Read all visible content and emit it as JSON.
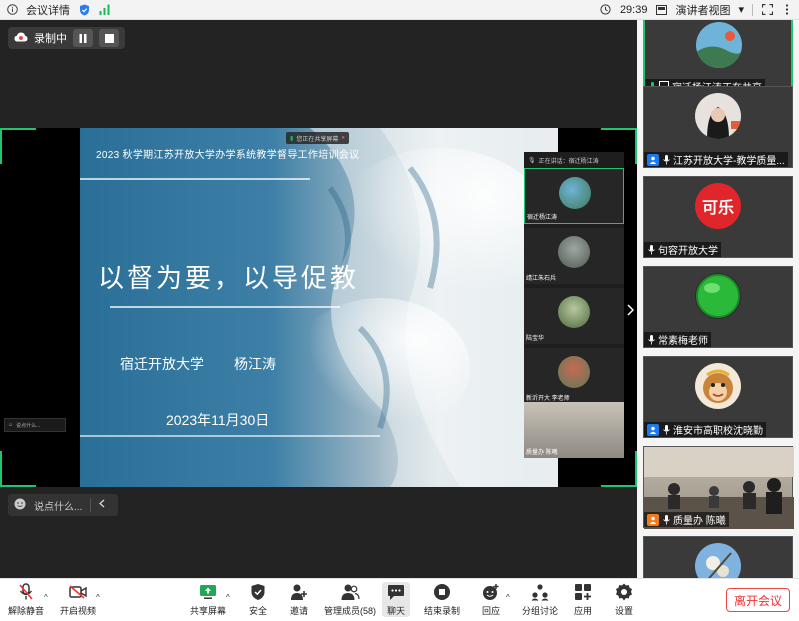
{
  "topbar": {
    "meeting_details": "会议详情",
    "time": "29:39",
    "view_mode": "演讲者视图"
  },
  "recording": {
    "label": "录制中"
  },
  "slide": {
    "header": "2023 秋学期江苏开放大学办学系统教学督导工作培训会议",
    "main_title": "以督为要，以导促教",
    "organization": "宿迁开放大学",
    "presenter": "杨江涛",
    "date": "2023年11月30日",
    "share_notice": "您正在共享屏幕",
    "inner_speaking": "正在讲话：宿迁杨江涛",
    "inner_tiles": [
      "宿迁杨江涛",
      "靖江朱石兵",
      "陆宝华",
      "新沂开大 李老师",
      "质量办 陈曦"
    ],
    "inner_chat": "说点什么..."
  },
  "chat": {
    "placeholder": "说点什么..."
  },
  "sidebar": {
    "participants": [
      {
        "name": "宿迁杨江涛正在共享"
      },
      {
        "name": "江苏开放大学-教学质量..."
      },
      {
        "name": "句容开放大学",
        "logo_text": "可乐"
      },
      {
        "name": "常素梅老师"
      },
      {
        "name": "淮安市高职校沈晓勤"
      },
      {
        "name": "质量办 陈曦"
      },
      {
        "name": ""
      }
    ]
  },
  "toolbar": {
    "unmute": "解除静音",
    "start_video": "开启视频",
    "share_screen": "共享屏幕",
    "security": "安全",
    "invite": "邀请",
    "manage_members": "管理成员(58)",
    "chat": "聊天",
    "end_recording": "结束录制",
    "reactions": "回应",
    "breakout": "分组讨论",
    "apps": "应用",
    "settings": "设置",
    "leave": "离开会议"
  },
  "colors": {
    "accent_green": "#20c36e",
    "leave_red": "#e33333",
    "host_blue": "#1e78f0"
  }
}
